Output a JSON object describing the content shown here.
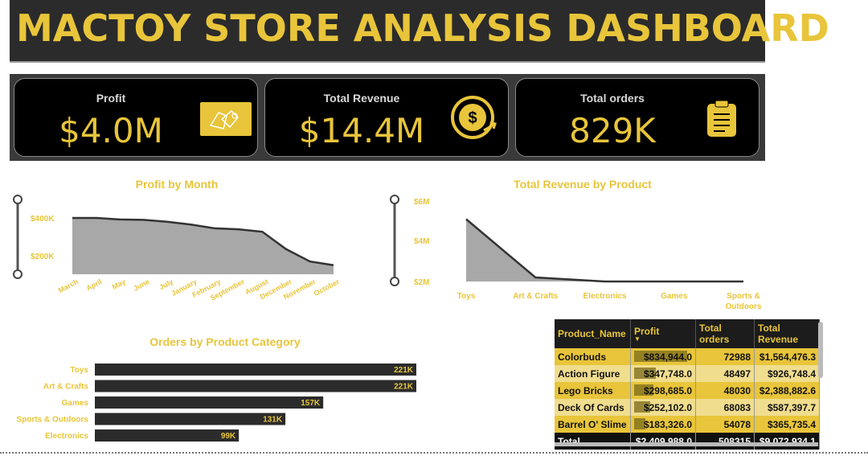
{
  "title": "MACTOY STORE ANALYSIS DASHBOARD",
  "kpis": [
    {
      "label": "Profit",
      "value": "$4.0M",
      "icon": "gloves-card-icon"
    },
    {
      "label": "Total Revenue",
      "value": "$14.4M",
      "icon": "dollar-refresh-icon"
    },
    {
      "label": "Total orders",
      "value": "829K",
      "icon": "clipboard-icon"
    }
  ],
  "colors": {
    "accent": "#e8c53a",
    "dark": "#2b2b2b",
    "area": "#a8a8a8",
    "bar": "#2b2b2b"
  },
  "profit_by_month": {
    "title": "Profit by Month",
    "y_ticks": [
      "$400K",
      "$200K"
    ]
  },
  "revenue_by_product": {
    "title": "Total Revenue by Product",
    "y_ticks": [
      "$6M",
      "$4M",
      "$2M"
    ],
    "x_labels": [
      "Toys",
      "Art & Crafts",
      "Electronics",
      "Games",
      "Sports & Outdoors"
    ]
  },
  "orders_by_category": {
    "title": "Orders by Product Category"
  },
  "chart_data": [
    {
      "type": "area",
      "title": "Profit by Month",
      "categories": [
        "March",
        "April",
        "May",
        "June",
        "July",
        "January",
        "February",
        "September",
        "August",
        "December",
        "November",
        "October"
      ],
      "values": [
        400000,
        400000,
        392000,
        390000,
        380000,
        365000,
        345000,
        340000,
        327000,
        235000,
        170000,
        150000
      ],
      "ylim": [
        0,
        450000
      ]
    },
    {
      "type": "area",
      "title": "Total Revenue by Product",
      "categories": [
        "Toys",
        "Art & Crafts",
        "Electronics",
        "Games",
        "Sports & Outdoors"
      ],
      "values": [
        5100000,
        2200000,
        1600000,
        1550000,
        1450000
      ],
      "ylim": [
        1500000,
        6000000
      ]
    },
    {
      "type": "bar",
      "title": "Orders by Product Category",
      "categories": [
        "Toys",
        "Art & Crafts",
        "Games",
        "Sports & Outdoors",
        "Electronics"
      ],
      "values": [
        221000,
        221000,
        157000,
        131000,
        99000
      ],
      "labels": [
        "221K",
        "221K",
        "157K",
        "131K",
        "99K"
      ]
    }
  ],
  "table": {
    "headers": [
      "Product_Name",
      "Profit",
      "Total orders",
      "Total Revenue"
    ],
    "rows": [
      {
        "name": "Colorbuds",
        "profit": "$834,944.0",
        "profit_value": 834944,
        "orders": "72988",
        "revenue": "$1,564,476.3"
      },
      {
        "name": "Action Figure",
        "profit": "$347,748.0",
        "profit_value": 347748,
        "orders": "48497",
        "revenue": "$926,748.4"
      },
      {
        "name": "Lego Bricks",
        "profit": "$298,685.0",
        "profit_value": 298685,
        "orders": "48030",
        "revenue": "$2,388,882.6"
      },
      {
        "name": "Deck Of Cards",
        "profit": "$252,102.0",
        "profit_value": 252102,
        "orders": "68083",
        "revenue": "$587,397.7"
      },
      {
        "name": "Barrel O' Slime",
        "profit": "$183,326.0",
        "profit_value": 183326,
        "orders": "54078",
        "revenue": "$365,735.4"
      }
    ],
    "total": {
      "name": "Total",
      "profit": "$2,409,988.0",
      "orders": "508315",
      "revenue": "$9,072,934.1"
    }
  }
}
